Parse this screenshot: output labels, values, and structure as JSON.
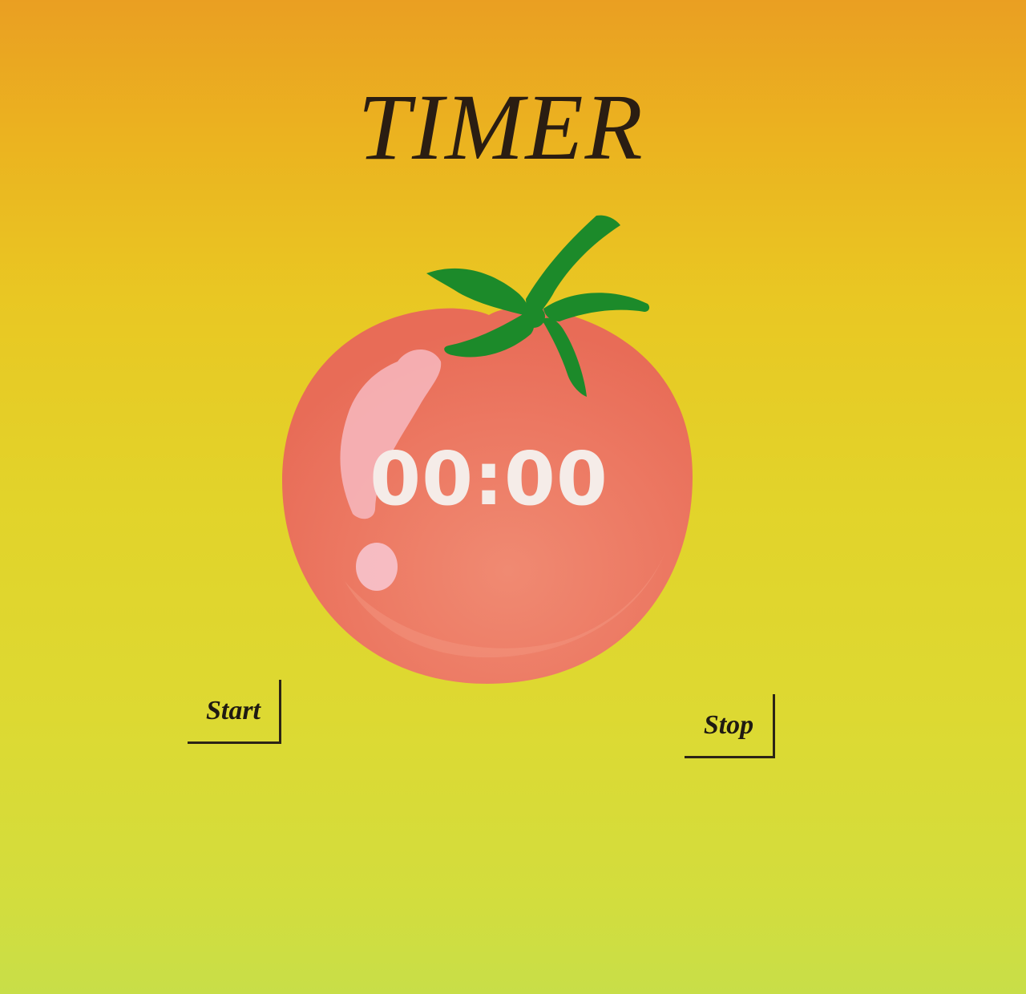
{
  "title": "TIMER",
  "timer": {
    "display": "00:00"
  },
  "controls": {
    "start_label": "Start",
    "stop_label": "Stop"
  },
  "icons": {
    "tomato": "tomato-icon"
  },
  "colors": {
    "background_top": "#ea9f22",
    "background_bottom": "#c8de48",
    "tomato": "#ec7a62",
    "leaves": "#1c8a2a",
    "timer_text": "#f5ece8",
    "title_text": "#2a1d12"
  }
}
